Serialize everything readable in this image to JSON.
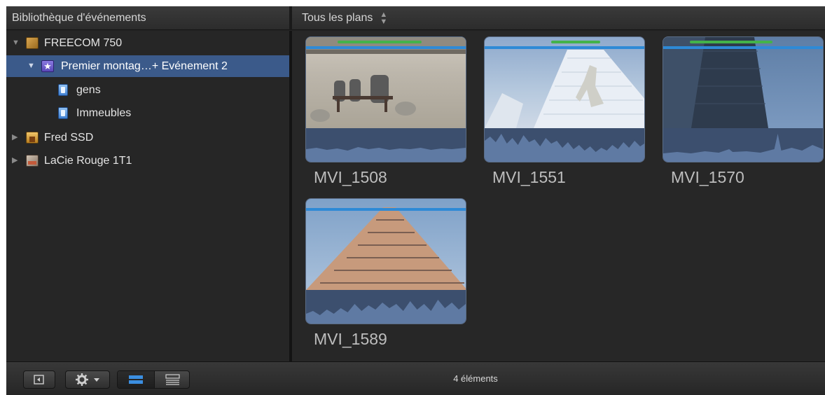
{
  "header": {
    "library_title": "Bibliothèque d'événements",
    "browser_filter": "Tous les plans"
  },
  "sidebar": {
    "items": [
      {
        "label": "FREECOM 750",
        "icon": "drive-icon",
        "expanded": true
      },
      {
        "label": "Premier montag…+ Evénement 2",
        "icon": "event-star-icon",
        "expanded": true,
        "selected": true
      },
      {
        "label": "gens",
        "icon": "keyword-collection-icon"
      },
      {
        "label": "Immeubles",
        "icon": "keyword-collection-icon"
      },
      {
        "label": "Fred SSD",
        "icon": "drive-icon",
        "expanded": false
      },
      {
        "label": "LaCie Rouge 1T1",
        "icon": "drive-icon",
        "expanded": false
      }
    ]
  },
  "browser": {
    "clips": [
      {
        "name": "MVI_1508"
      },
      {
        "name": "MVI_1551"
      },
      {
        "name": "MVI_1570"
      },
      {
        "name": "MVI_1589"
      }
    ]
  },
  "footer": {
    "item_count": "4 éléments"
  },
  "colors": {
    "selection": "#3b5a8a",
    "waveform": "#3c4f6e",
    "favorite_bar": "#2e8ad6",
    "keyword_bar": "#43b34a"
  }
}
